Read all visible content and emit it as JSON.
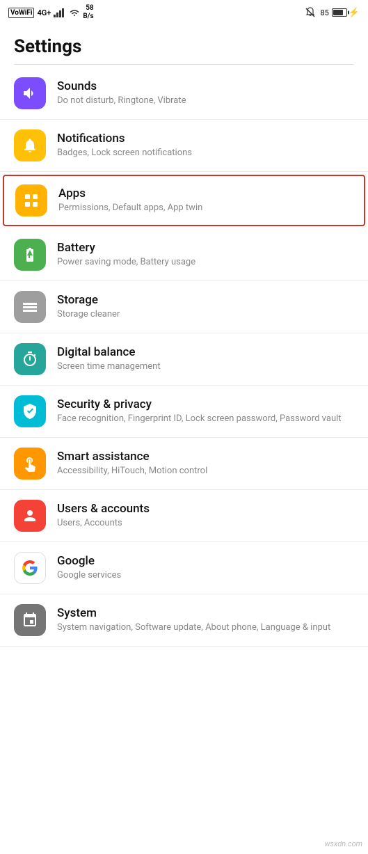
{
  "statusBar": {
    "leftItems": [
      "VoWiFi",
      "4G+",
      "signal",
      "wifi",
      "58 B/s"
    ],
    "networkLabel": "VoWiFi",
    "networkType": "4G+",
    "speed": "58",
    "speedUnit": "B/s",
    "bellMuted": true,
    "batteryPercent": "85",
    "charging": true
  },
  "pageTitle": "Settings",
  "settings": [
    {
      "id": "sounds",
      "iconColor": "icon-purple",
      "iconGlyph": "🔊",
      "title": "Sounds",
      "subtitle": "Do not disturb, Ringtone, Vibrate",
      "highlighted": false
    },
    {
      "id": "notifications",
      "iconColor": "icon-yellow",
      "iconGlyph": "🔔",
      "title": "Notifications",
      "subtitle": "Badges, Lock screen notifications",
      "highlighted": false
    },
    {
      "id": "apps",
      "iconColor": "icon-yellow2",
      "iconGlyph": "⊞",
      "title": "Apps",
      "subtitle": "Permissions, Default apps, App twin",
      "highlighted": true
    },
    {
      "id": "battery",
      "iconColor": "icon-green",
      "iconGlyph": "🔋",
      "title": "Battery",
      "subtitle": "Power saving mode, Battery usage",
      "highlighted": false
    },
    {
      "id": "storage",
      "iconColor": "icon-grey",
      "iconGlyph": "🗄",
      "title": "Storage",
      "subtitle": "Storage cleaner",
      "highlighted": false
    },
    {
      "id": "digital-balance",
      "iconColor": "icon-teal",
      "iconGlyph": "⏳",
      "title": "Digital balance",
      "subtitle": "Screen time management",
      "highlighted": false
    },
    {
      "id": "security-privacy",
      "iconColor": "icon-cyan",
      "iconGlyph": "🛡",
      "title": "Security & privacy",
      "subtitle": "Face recognition, Fingerprint ID, Lock screen password, Password vault",
      "highlighted": false
    },
    {
      "id": "smart-assistance",
      "iconColor": "icon-orange",
      "iconGlyph": "✋",
      "title": "Smart assistance",
      "subtitle": "Accessibility, HiTouch, Motion control",
      "highlighted": false
    },
    {
      "id": "users-accounts",
      "iconColor": "icon-red",
      "iconGlyph": "👤",
      "title": "Users & accounts",
      "subtitle": "Users, Accounts",
      "highlighted": false
    },
    {
      "id": "google",
      "iconColor": "icon-white-border",
      "iconGlyph": "G",
      "title": "Google",
      "subtitle": "Google services",
      "highlighted": false
    },
    {
      "id": "system",
      "iconColor": "icon-dark-grey",
      "iconGlyph": "ℹ",
      "title": "System",
      "subtitle": "System navigation, Software update, About phone, Language & input",
      "highlighted": false
    }
  ],
  "watermark": "wsxdn.com"
}
